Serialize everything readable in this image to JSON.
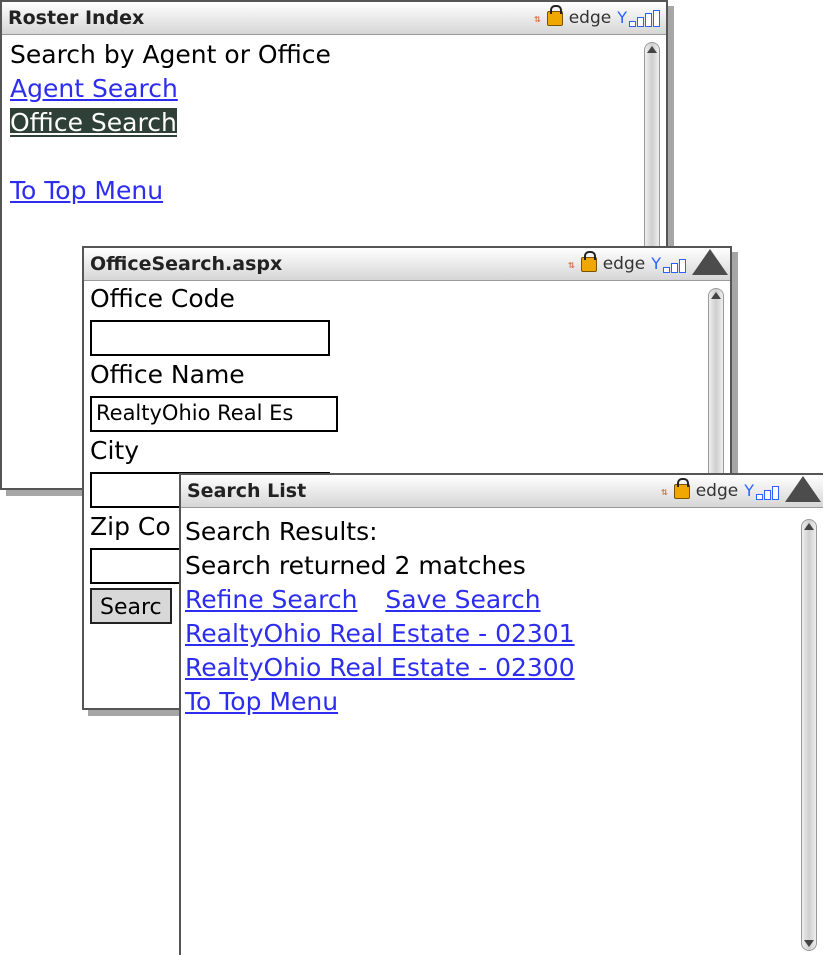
{
  "status": {
    "network": "edge"
  },
  "roster": {
    "title": "Roster Index",
    "heading": "Search by Agent or Office",
    "links": [
      "Agent Search",
      "Office Search",
      "To Top Menu"
    ]
  },
  "office": {
    "title": "OfficeSearch.aspx",
    "fields": {
      "office_code_label": "Office Code",
      "office_code_value": "",
      "office_name_label": "Office Name",
      "office_name_value": "RealtyOhio Real Es",
      "city_label": "City",
      "city_value": "",
      "zip_label": "Zip Co",
      "zip_value": ""
    },
    "search_button": "Searc"
  },
  "results": {
    "title": "Search List",
    "heading": "Search Results:",
    "summary": "Search returned 2 matches",
    "refine": "Refine Search",
    "save": "Save Search",
    "items": [
      "RealtyOhio Real Estate - 02301",
      "RealtyOhio Real Estate - 02300"
    ],
    "top_menu": "To Top Menu"
  }
}
